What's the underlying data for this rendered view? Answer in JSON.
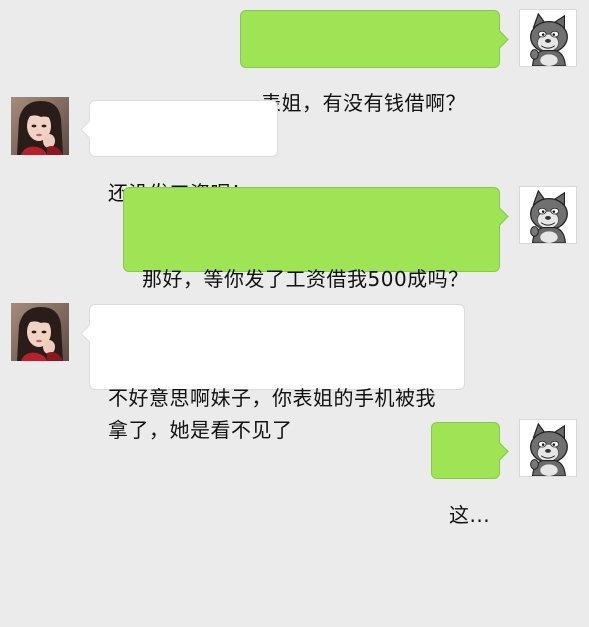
{
  "chat": {
    "messages": [
      {
        "id": 1,
        "sender": "self",
        "avatar": "cat-avatar",
        "text": "表姐，有没有钱借啊？"
      },
      {
        "id": 2,
        "sender": "other",
        "avatar": "girl-avatar",
        "text": "还没发工资呢！"
      },
      {
        "id": 3,
        "sender": "self",
        "avatar": "cat-avatar",
        "text": "那好，等你发了工资借我500成吗？"
      },
      {
        "id": 4,
        "sender": "other",
        "avatar": "girl-avatar",
        "text": "不好意思啊妹子，你表姐的手机被我拿了，她是看不见了"
      },
      {
        "id": 5,
        "sender": "self",
        "avatar": "cat-avatar",
        "text": "这..."
      }
    ]
  },
  "colors": {
    "background": "#ebebeb",
    "outgoing_bubble": "#9ee454",
    "incoming_bubble": "#ffffff",
    "text": "#111111"
  }
}
